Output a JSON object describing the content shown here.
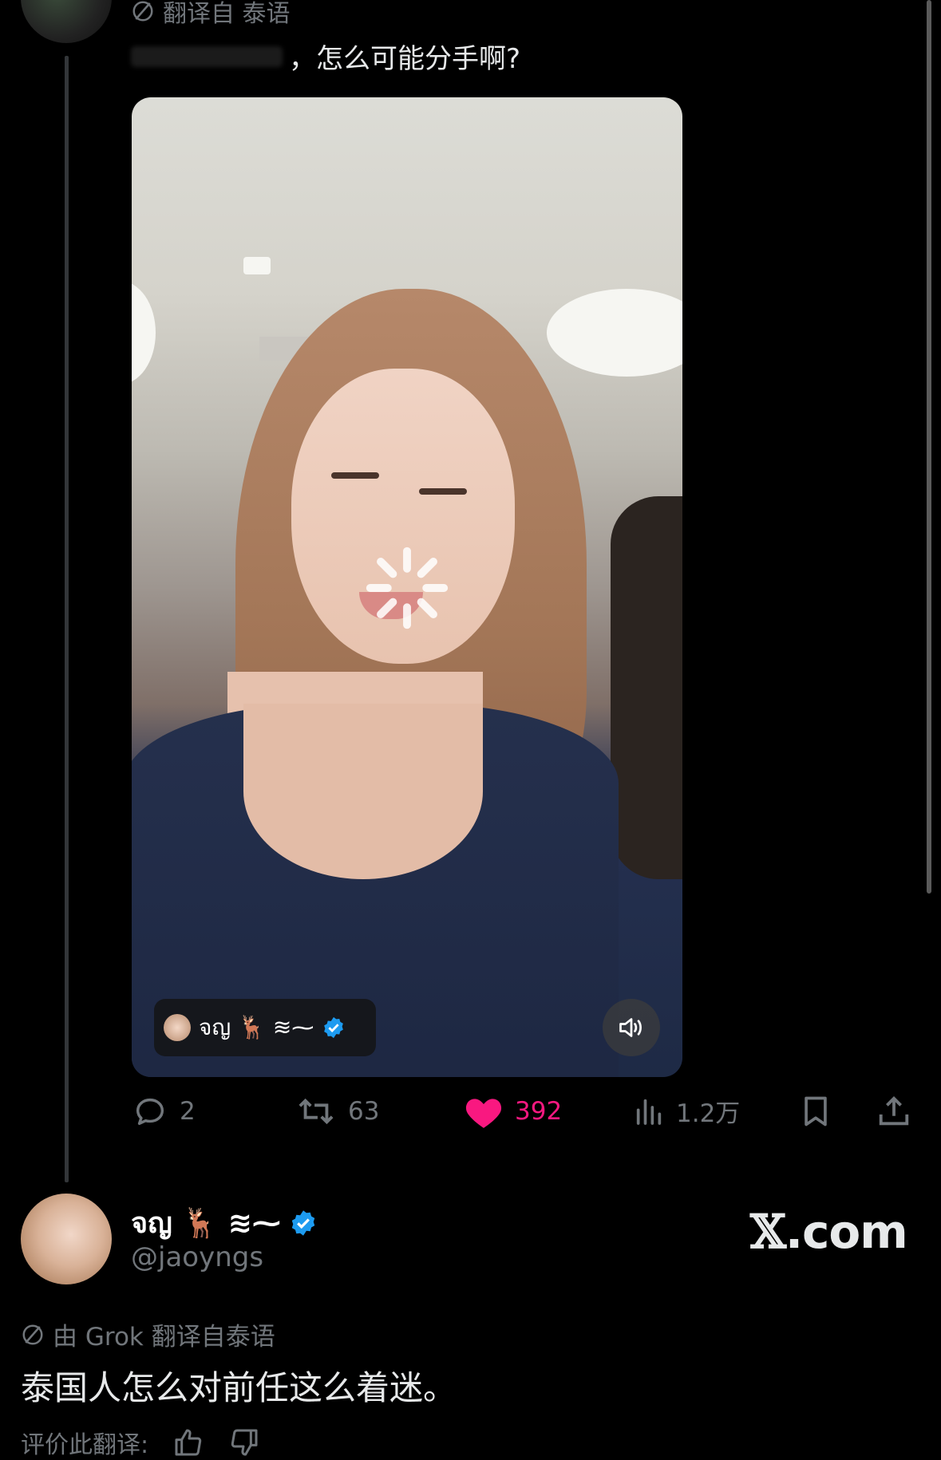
{
  "post": {
    "translated_from_label": "翻译自 泰语",
    "text": "，怎么可能分手啊?",
    "video": {
      "creator_name": "จญ 🦌 ≋⁓",
      "verified": true
    },
    "actions": {
      "replies": "2",
      "reposts": "63",
      "likes": "392",
      "views": "1.2万"
    }
  },
  "quoted_author": {
    "display_name": "จญ 🦌 ≋⁓",
    "handle": "@jaoyngs",
    "verified": true
  },
  "watermark": {
    "x": "𝕏",
    "rest": ".com"
  },
  "translation": {
    "label": "由 Grok 翻译自泰语",
    "text": "泰国人怎么对前任这么着迷。",
    "rate_label": "评价此翻译:"
  },
  "colors": {
    "background": "#000000",
    "like": "#f91880",
    "verified": "#1d9bf0",
    "muted": "#71767b"
  }
}
